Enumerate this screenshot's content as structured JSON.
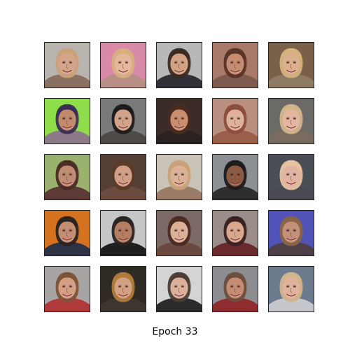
{
  "caption": "Epoch 33",
  "grid": {
    "rows": 5,
    "cols": 5,
    "tiles": [
      {
        "subject": "generated-face",
        "background": "#b9b4ae",
        "skin": "#d6a488",
        "hair": "#c9a27a",
        "clothing": "#8a6f63"
      },
      {
        "subject": "generated-face",
        "background": "#d98aa9",
        "skin": "#e7b79d",
        "hair": "#d7b07e",
        "clothing": "#b88f86"
      },
      {
        "subject": "generated-face",
        "background": "#b8b8b8",
        "skin": "#d2a283",
        "hair": "#3b2a22",
        "clothing": "#2f3136"
      },
      {
        "subject": "generated-face",
        "background": "#a9796a",
        "skin": "#c58c72",
        "hair": "#5b3427",
        "clothing": "#7f5b4f"
      },
      {
        "subject": "generated-face",
        "background": "#7a6048",
        "skin": "#dcb08d",
        "hair": "#d6b37e",
        "clothing": "#8f7a63"
      },
      {
        "subject": "generated-face",
        "background": "#8fdd4b",
        "skin": "#c28a6c",
        "hair": "#3c2c55",
        "clothing": "#8d7a88"
      },
      {
        "subject": "generated-face",
        "background": "#7a7a7a",
        "skin": "#d2a48b",
        "hair": "#1c1c1c",
        "clothing": "#4d4a48"
      },
      {
        "subject": "generated-face",
        "background": "#3b2c28",
        "skin": "#c98d6f",
        "hair": "#4a2b21",
        "clothing": "#2a2220"
      },
      {
        "subject": "generated-face",
        "background": "#b98f80",
        "skin": "#dfb09a",
        "hair": "#8c4e3c",
        "clothing": "#9a5f4a"
      },
      {
        "subject": "generated-face",
        "background": "#6b6a66",
        "skin": "#e3b79f",
        "hair": "#d2b58b",
        "clothing": "#7a6b60"
      },
      {
        "subject": "generated-face",
        "background": "#9bb16f",
        "skin": "#c08c73",
        "hair": "#4b2c25",
        "clothing": "#5c3b36"
      },
      {
        "subject": "generated-face",
        "background": "#564036",
        "skin": "#d19f85",
        "hair": "#5b3b2a",
        "clothing": "#6c4c40"
      },
      {
        "subject": "generated-face",
        "background": "#c9c3b8",
        "skin": "#dcb296",
        "hair": "#c9a27a",
        "clothing": "#9a7c66"
      },
      {
        "subject": "generated-face",
        "background": "#8c8f93",
        "skin": "#8c5a42",
        "hair": "#1d1b1c",
        "clothing": "#2f2d2d"
      },
      {
        "subject": "generated-face",
        "background": "#4b4e55",
        "skin": "#e3b3a2",
        "hair": "#e6c3a2",
        "clothing": "#4a4b52"
      },
      {
        "subject": "generated-face",
        "background": "#d4721f",
        "skin": "#c48e74",
        "hair": "#2a2320",
        "clothing": "#2d3245"
      },
      {
        "subject": "generated-face",
        "background": "#c6c6c6",
        "skin": "#b67f63",
        "hair": "#2b2522",
        "clothing": "#1f1f22"
      },
      {
        "subject": "generated-face",
        "background": "#7b6a66",
        "skin": "#dbb197",
        "hair": "#4b2b22",
        "clothing": "#6a4a40"
      },
      {
        "subject": "generated-face",
        "background": "#9b8d8a",
        "skin": "#d9a88f",
        "hair": "#3a2220",
        "clothing": "#6a2b2f"
      },
      {
        "subject": "generated-face",
        "background": "#5052b5",
        "skin": "#c4907a",
        "hair": "#8a6447",
        "clothing": "#4e3e45"
      },
      {
        "subject": "generated-face",
        "background": "#a7a4a3",
        "skin": "#d59f85",
        "hair": "#7d5338",
        "clothing": "#b03a3a"
      },
      {
        "subject": "generated-face",
        "background": "#2f2a24",
        "skin": "#d3a081",
        "hair": "#b07c3a",
        "clothing": "#3c3530"
      },
      {
        "subject": "generated-face",
        "background": "#d4d4d4",
        "skin": "#ddb09b",
        "hair": "#4b3d33",
        "clothing": "#2b2b2e"
      },
      {
        "subject": "generated-face",
        "background": "#8b8d91",
        "skin": "#c48d73",
        "hair": "#6b4f3e",
        "clothing": "#8f2c30"
      },
      {
        "subject": "generated-face",
        "background": "#6b7a8c",
        "skin": "#e1b29c",
        "hair": "#d1b58c",
        "clothing": "#c5c7cc"
      }
    ]
  }
}
